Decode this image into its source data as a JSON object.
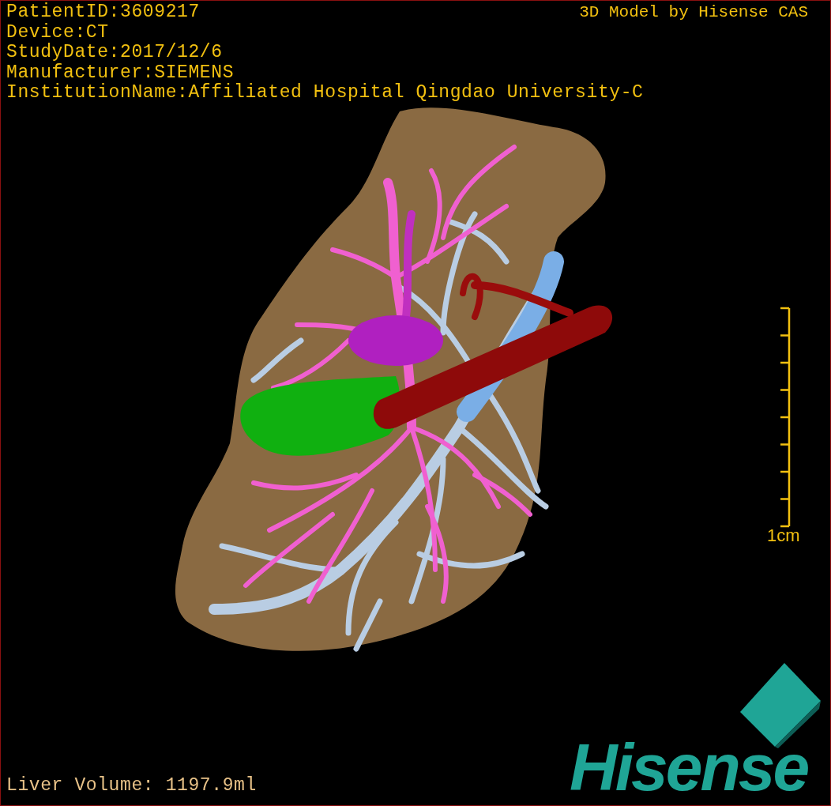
{
  "study_info": {
    "lines": [
      "PatientID:3609217",
      "Device:CT",
      "StudyDate:2017/12/6",
      "Manufacturer:SIEMENS",
      "InstitutionName:Affiliated Hospital Qingdao University-C"
    ]
  },
  "credit": "3D Model by Hisense CAS",
  "scale_bar": {
    "label": "1cm"
  },
  "measurement": "Liver Volume: 1197.9ml",
  "logo": {
    "text": "Hisense"
  }
}
